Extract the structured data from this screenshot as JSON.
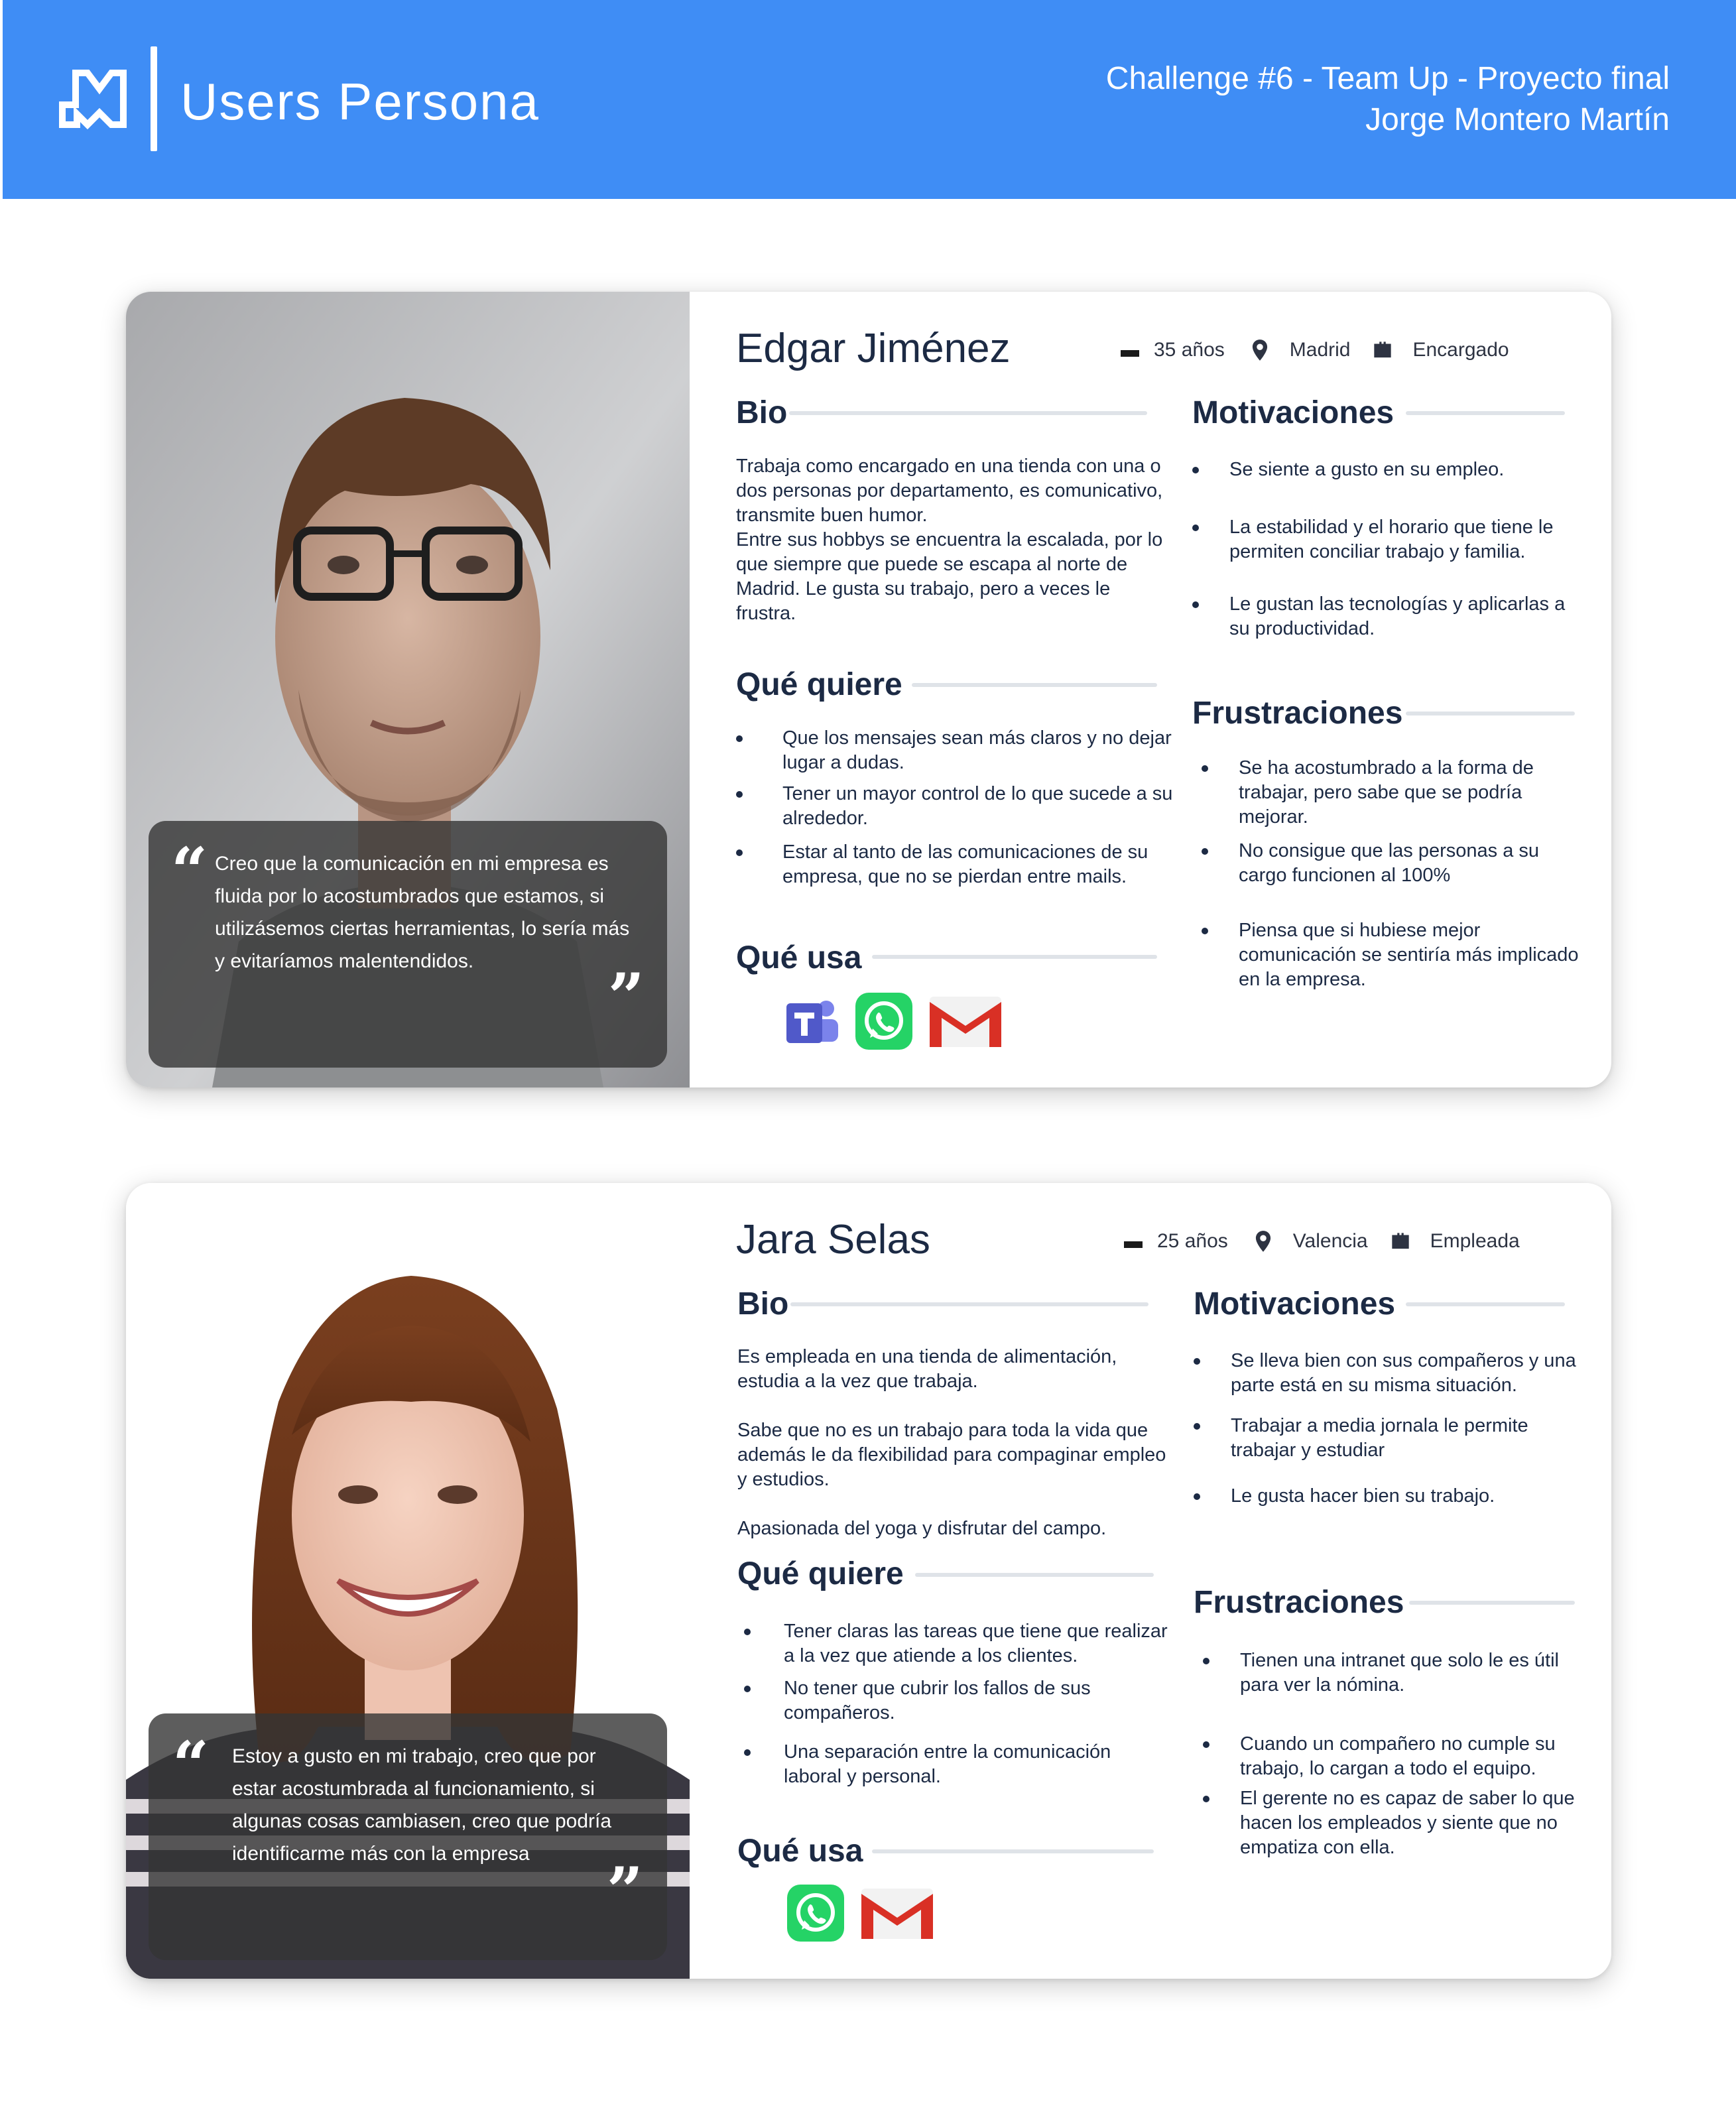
{
  "header": {
    "title": "Users Persona",
    "subtitle_line1": "Challenge #6 - Team Up - Proyecto final",
    "subtitle_line2": "Jorge Montero Martín",
    "background": "#3f8df5"
  },
  "personas": [
    {
      "name": "Edgar Jiménez",
      "age": "35 años",
      "location": "Madrid",
      "role": "Encargado",
      "quote": "Creo que la comunicación en mi empresa es fluida por lo acostumbrados que estamos, si utilizásemos ciertas herramientas, lo sería más y evitaríamos malentendidos.",
      "bio_title": "Bio",
      "bio": "Trabaja como encargado en una tienda con una o dos personas por departamento, es comunicativo, transmite buen humor.\nEntre sus hobbys se encuentra la escalada, por lo que siempre que puede se escapa al norte de Madrid. Le gusta su trabajo, pero a veces le frustra.",
      "wants_title": "Qué quiere",
      "wants": [
        "Que los mensajes sean más claros y no dejar lugar a dudas.",
        "Tener un mayor control de lo que sucede a su alrededor.",
        "Estar al tanto de las comunicaciones de su empresa, que no se pierdan entre mails."
      ],
      "uses_title": "Qué usa",
      "uses": [
        "teams-icon",
        "whatsapp-icon",
        "gmail-icon"
      ],
      "motivations_title": "Motivaciones",
      "motivations": [
        "Se siente a gusto en su empleo.",
        "La estabilidad y el horario que tiene le permiten conciliar trabajo y familia.",
        "Le gustan las tecnologías y aplicarlas a su productividad."
      ],
      "frustrations_title": "Frustraciones",
      "frustrations": [
        "Se ha acostumbrado a la forma de trabajar, pero sabe que se podría mejorar.",
        "No consigue que las personas a su cargo funcionen al 100%",
        "Piensa que si hubiese mejor comunicación se sentiría más implicado en la empresa."
      ]
    },
    {
      "name": "Jara Selas",
      "age": "25 años",
      "location": "Valencia",
      "role": "Empleada",
      "quote": "Estoy a gusto en mi trabajo, creo que por estar acostumbrada al funcionamiento, si algunas cosas cambiasen, creo que podría identificarme más con la empresa",
      "bio_title": "Bio",
      "bio": "Es empleada en una tienda de alimentación, estudia a la vez que trabaja.\n\nSabe que no es un trabajo para toda la vida que además le da flexibilidad para compaginar empleo y estudios.\n\nApasionada del yoga y disfrutar del campo.",
      "wants_title": "Qué quiere",
      "wants": [
        "Tener claras las tareas que tiene que realizar a la vez que atiende a los clientes.",
        "No tener que cubrir los fallos de sus compañeros.",
        "Una separación entre la comunicación laboral y personal."
      ],
      "uses_title": "Qué usa",
      "uses": [
        "whatsapp-icon",
        "gmail-icon"
      ],
      "motivations_title": "Motivaciones",
      "motivations": [
        "Se lleva bien con sus compañeros y una parte está en su misma situación.",
        "Trabajar a media jornala le permite trabajar y estudiar",
        "Le gusta hacer bien su trabajo."
      ],
      "frustrations_title": "Frustraciones",
      "frustrations": [
        "Tienen una intranet que solo le es útil para ver la nómina.",
        "Cuando un compañero no cumple su trabajo, lo cargan a todo el equipo.",
        "El gerente no es capaz de saber lo que hacen los empleados y siente que no empatiza con ella."
      ]
    }
  ],
  "colors": {
    "accent": "#3f8df5",
    "text": "#1c2a44",
    "divider": "#dfe3e8",
    "whatsapp": "#25d366",
    "gmail": "#d93025",
    "teams": "#5059c9"
  }
}
